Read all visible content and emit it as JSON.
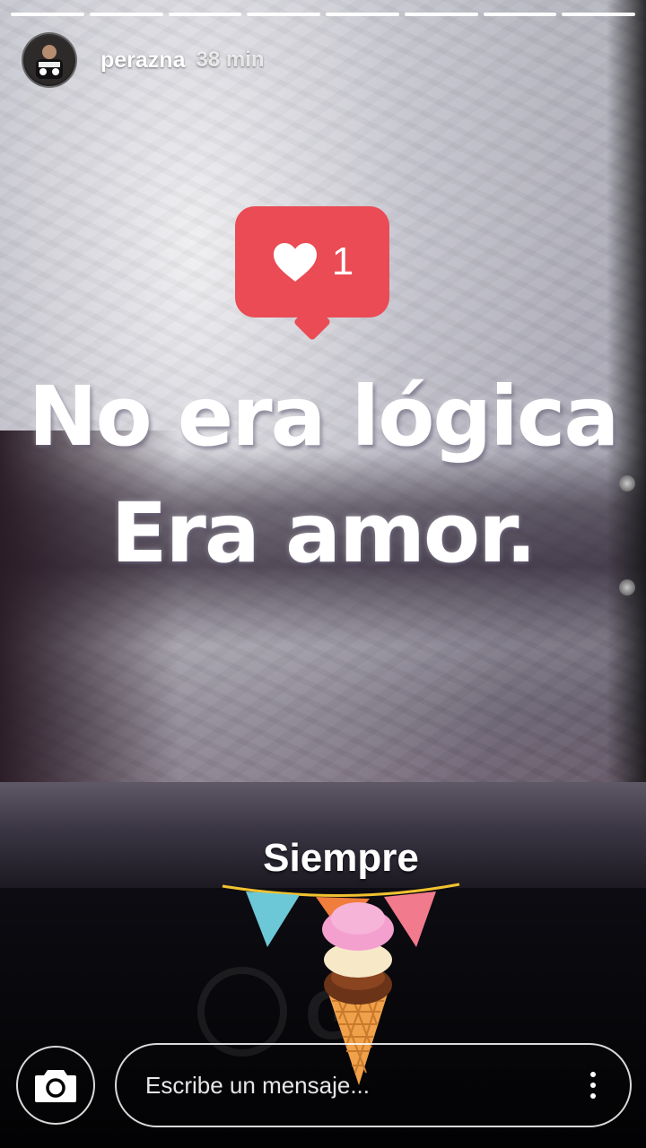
{
  "story": {
    "progress_segments": 8,
    "user": {
      "username": "perazna",
      "time_ago": "38 min",
      "avatar_icon": "profile-photo"
    },
    "like_notification": {
      "icon": "heart-icon",
      "count": "1",
      "color": "#ea4b55"
    },
    "quote": {
      "line1": "No era lógica",
      "line2": "Era amor."
    },
    "sticker": {
      "text": "Siempre",
      "icon": "ice-cream-bunting-sticker"
    }
  },
  "bottom_bar": {
    "camera_icon": "camera-icon",
    "message_placeholder": "Escribe un mensaje...",
    "options_icon": "more-vertical-icon"
  }
}
